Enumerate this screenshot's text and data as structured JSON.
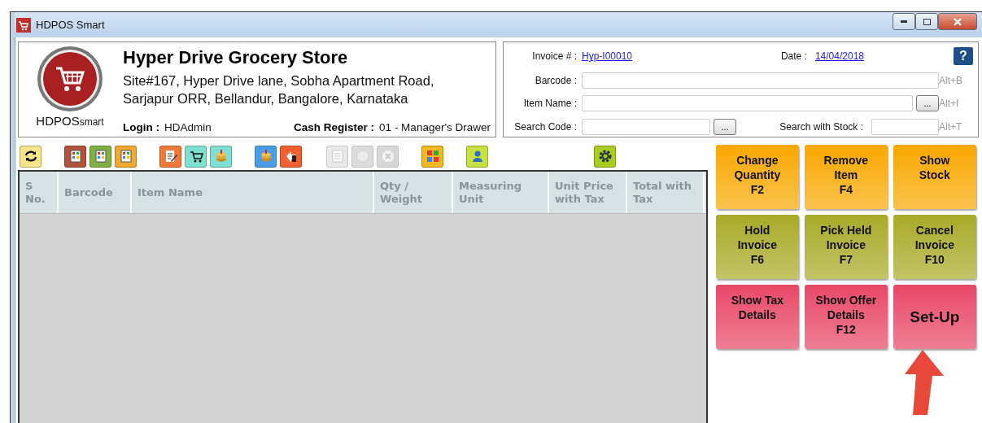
{
  "window": {
    "title": "HDPOS Smart"
  },
  "store": {
    "logo_text": "HDPOS",
    "logo_suffix": "smart",
    "name": "Hyper Drive Grocery Store",
    "address": [
      "Site#167, Hyper Drive lane, Sobha Apartment Road,",
      "Sarjapur ORR, Bellandur, Bangalore, Karnataka"
    ],
    "login_label": "Login :",
    "login": "HDAdmin",
    "register_label": "Cash Register :",
    "register": "01 - Manager's Drawer"
  },
  "invoice": {
    "number_label": "Invoice # :",
    "number": "Hyp-I00010",
    "date_label": "Date :",
    "date": "14/04/2018",
    "help": "?",
    "barcode_label": "Barcode :",
    "barcode_shortcut": "Alt+B",
    "item_label": "Item Name :",
    "item_button": "...",
    "item_shortcut": "Alt+I",
    "code_label": "Search Code :",
    "code_button": "...",
    "stock_label": "Search with Stock :",
    "stock_shortcut": "Alt+T"
  },
  "toolbar": [
    {
      "kind": "refresh",
      "color": "#f7e48a",
      "disabled": false
    },
    {
      "kind": "register",
      "color": "#b5533a",
      "disabled": false
    },
    {
      "kind": "register",
      "color": "#7fb040",
      "disabled": false
    },
    {
      "kind": "register",
      "color": "#f0a830",
      "disabled": false
    },
    {
      "kind": "note",
      "color": "#f07838",
      "disabled": false
    },
    {
      "kind": "cart",
      "color": "#7ee0d0",
      "disabled": false
    },
    {
      "kind": "coins",
      "color": "#7ee0d0",
      "disabled": false
    },
    {
      "kind": "coins",
      "color": "#4a9ee8",
      "disabled": false
    },
    {
      "kind": "return",
      "color": "#f06030",
      "disabled": false
    },
    {
      "kind": "list",
      "color": "#d8d8d8",
      "disabled": true
    },
    {
      "kind": "spot",
      "color": "#c0c0c0",
      "disabled": true
    },
    {
      "kind": "close",
      "color": "#b8b8b8",
      "disabled": true
    },
    {
      "kind": "tiles",
      "color": "#f4b820",
      "disabled": false
    },
    {
      "kind": "user",
      "color": "#c8e040",
      "disabled": false
    },
    {
      "kind": "gear",
      "color": "#a8cc20",
      "disabled": false
    }
  ],
  "table": {
    "columns": [
      [
        "S",
        "No."
      ],
      [
        "Barcode"
      ],
      [
        "Item Name"
      ],
      [
        "Qty /",
        "Weight"
      ],
      [
        "Measuring",
        "Unit"
      ],
      [
        "Unit Price",
        "with Tax"
      ],
      [
        "Total with",
        "Tax"
      ]
    ]
  },
  "actions": [
    {
      "label": "Change Quantity",
      "key": "F2",
      "color": "#f8a800",
      "kind": "normal"
    },
    {
      "label": "Remove Item",
      "key": "F4",
      "color": "#f8a800",
      "kind": "normal"
    },
    {
      "label": "Show Stock",
      "color": "#f8a800",
      "kind": "normal"
    },
    {
      "label": "Hold Invoice",
      "key": "F6",
      "color": "#a8aa28",
      "kind": "normal"
    },
    {
      "label": "Pick Held Invoice",
      "key": "F7",
      "color": "#a8aa28",
      "kind": "normal"
    },
    {
      "label": "Cancel Invoice",
      "key": "F10",
      "color": "#a8aa28",
      "kind": "normal"
    },
    {
      "label": "Show Tax Details",
      "color": "#e84868",
      "kind": "normal"
    },
    {
      "label": "Show Offer Details",
      "key": "F12",
      "color": "#e84868",
      "kind": "normal"
    },
    {
      "label": "Set-Up",
      "color": "#e84868",
      "kind": "large"
    }
  ]
}
